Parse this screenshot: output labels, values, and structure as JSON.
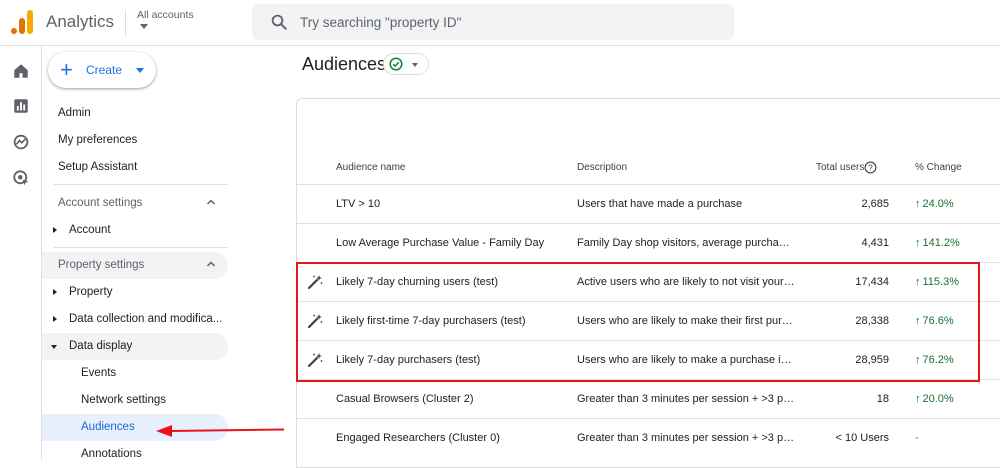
{
  "header": {
    "app_title": "Analytics",
    "account_label": "All accounts",
    "search_placeholder": "Try searching \"property ID\""
  },
  "sidebar": {
    "create_label": "Create",
    "items": [
      {
        "label": "Admin"
      },
      {
        "label": "My preferences"
      },
      {
        "label": "Setup Assistant"
      }
    ],
    "account_settings": {
      "label": "Account settings",
      "children": [
        {
          "label": "Account"
        }
      ]
    },
    "property_settings": {
      "label": "Property settings",
      "children": [
        {
          "label": "Property"
        },
        {
          "label": "Data collection and modifica..."
        },
        {
          "label": "Data display"
        }
      ],
      "data_display_children": [
        {
          "label": "Events"
        },
        {
          "label": "Network settings"
        },
        {
          "label": "Audiences"
        },
        {
          "label": "Annotations"
        }
      ]
    }
  },
  "main": {
    "title": "Audiences",
    "columns": {
      "name": "Audience name",
      "description": "Description",
      "users": "Total users",
      "change": "% Change"
    },
    "rows": [
      {
        "name": "LTV > 10",
        "description": "Users that have made a purchase",
        "users": "2,685",
        "change": "24.0%",
        "trend": "up",
        "predictive": false
      },
      {
        "name": "Low Average Purchase Value - Family Day",
        "description": "Family Day shop visitors, average purchase...",
        "users": "4,431",
        "change": "141.2%",
        "trend": "up",
        "predictive": false
      },
      {
        "name": "Likely 7-day churning users (test)",
        "description": "Active users who are likely to not visit your ...",
        "users": "17,434",
        "change": "115.3%",
        "trend": "up",
        "predictive": true
      },
      {
        "name": "Likely first-time 7-day purchasers (test)",
        "description": "Users who are likely to make their first purc...",
        "users": "28,338",
        "change": "76.6%",
        "trend": "up",
        "predictive": true
      },
      {
        "name": "Likely 7-day purchasers (test)",
        "description": "Users who are likely to make a purchase in ...",
        "users": "28,959",
        "change": "76.2%",
        "trend": "up",
        "predictive": true
      },
      {
        "name": "Casual Browsers (Cluster 2)",
        "description": "Greater than 3 minutes per session + >3 pa...",
        "users": "18",
        "change": "20.0%",
        "trend": "up",
        "predictive": false
      },
      {
        "name": "Engaged Researchers (Cluster 0)",
        "description": "Greater than 3 minutes per session + >3 pa...",
        "users": "< 10 Users",
        "change": "-",
        "trend": "none",
        "predictive": false
      }
    ]
  },
  "colors": {
    "accent": "#1a73e8",
    "positive": "#137333",
    "annotation_red": "#e8131b",
    "active_nav": "#e8f0fe"
  },
  "icons": {
    "rail": [
      "home-icon",
      "reports-icon",
      "explore-icon",
      "advertising-icon"
    ],
    "predictive": "magic-wand-icon"
  }
}
